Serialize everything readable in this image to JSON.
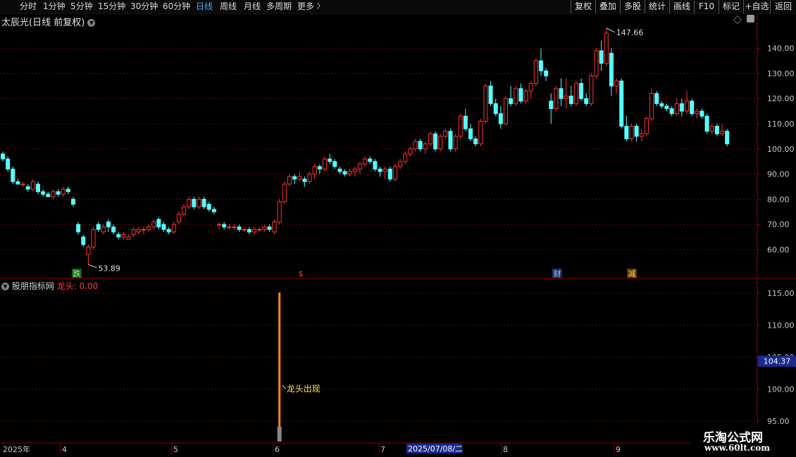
{
  "toolbar": {
    "periods": [
      {
        "label": "分时",
        "active": false
      },
      {
        "label": "1分钟",
        "active": false
      },
      {
        "label": "5分钟",
        "active": false
      },
      {
        "label": "15分钟",
        "active": false
      },
      {
        "label": "30分钟",
        "active": false
      },
      {
        "label": "60分钟",
        "active": false
      },
      {
        "label": "日线",
        "active": true
      },
      {
        "label": "周线",
        "active": false
      },
      {
        "label": "月线",
        "active": false
      },
      {
        "label": "多周期",
        "active": false
      },
      {
        "label": "更多",
        "active": false
      }
    ],
    "more_arrow": "〉",
    "right_buttons": [
      "复权",
      "叠加",
      "多股",
      "统计",
      "画线",
      "F10",
      "标记",
      "+自选",
      "返回"
    ]
  },
  "stock": {
    "title": "太辰光(日线 前复权)",
    "chevron": "chevron-down-icon"
  },
  "main_chart": {
    "price_ticks": [
      "140.00",
      "130.00",
      "120.00",
      "110.00",
      "100.00",
      "90.00",
      "80.00",
      "70.00",
      "60.00"
    ],
    "high_label": "147.66",
    "low_label": "53.89",
    "markers": [
      {
        "text": "跌",
        "type": "green-box"
      },
      {
        "text": "$",
        "type": "red-text"
      },
      {
        "text": "财",
        "type": "blue-box"
      },
      {
        "text": "减",
        "type": "amber-box"
      }
    ]
  },
  "sub_chart": {
    "title": "股朋指标网",
    "indicator_label": "龙头: 0.00",
    "ticks": [
      "115.00",
      "110.00",
      "105.00",
      "100.00",
      "95.00"
    ],
    "current_value": "104.37",
    "signal_text": "龙头出现"
  },
  "time_axis": {
    "labels": [
      "2025年",
      "4",
      "5",
      "6",
      "7",
      "8",
      "9"
    ],
    "cursor_date": "2025/07/08/二"
  },
  "watermark": {
    "line1": "乐淘公式网",
    "line2": "www.60lt.com"
  },
  "colors": {
    "up": "#ff3232",
    "down": "#54ffff",
    "grid": "#6e0000",
    "axis": "#8a0000",
    "accent": "#4aa8ff",
    "signal": "#ff8c00"
  },
  "chart_data": {
    "type": "candlestick",
    "ylim": [
      50,
      150
    ],
    "y_ticks": [
      60,
      70,
      80,
      90,
      100,
      110,
      120,
      130,
      140
    ],
    "high": 147.66,
    "low": 53.89,
    "candles": [
      [
        98,
        99,
        95,
        96
      ],
      [
        96,
        97,
        91,
        92
      ],
      [
        92,
        93,
        86,
        87
      ],
      [
        87,
        88,
        86,
        86
      ],
      [
        86,
        87,
        85,
        86
      ],
      [
        85,
        86,
        83,
        84
      ],
      [
        84,
        88,
        83,
        87
      ],
      [
        86,
        87,
        82,
        83
      ],
      [
        83,
        84,
        81,
        82
      ],
      [
        82,
        83,
        81,
        81
      ],
      [
        81,
        84,
        80,
        83
      ],
      [
        83,
        84,
        81,
        82
      ],
      [
        82,
        85,
        81,
        84
      ],
      [
        84,
        85,
        82,
        83
      ],
      [
        80,
        81,
        77,
        78
      ],
      [
        70,
        71,
        66,
        67
      ],
      [
        65,
        66,
        61,
        62
      ],
      [
        58,
        62,
        54,
        61
      ],
      [
        61,
        69,
        60,
        68
      ],
      [
        70,
        71,
        67,
        68
      ],
      [
        67,
        70,
        66,
        69
      ],
      [
        71,
        72,
        67,
        69
      ],
      [
        69,
        70,
        66,
        67
      ],
      [
        66,
        67,
        64,
        65
      ],
      [
        65,
        67,
        64,
        66
      ],
      [
        64,
        66,
        64,
        65
      ],
      [
        66,
        69,
        65,
        68
      ],
      [
        67,
        69,
        66,
        68
      ],
      [
        68,
        69,
        66,
        68
      ],
      [
        68,
        70,
        67,
        69
      ],
      [
        69,
        72,
        68,
        71
      ],
      [
        72,
        73,
        68,
        69
      ],
      [
        70,
        71,
        67,
        68
      ],
      [
        68,
        69,
        66,
        67
      ],
      [
        67,
        71,
        66,
        70
      ],
      [
        71,
        75,
        70,
        74
      ],
      [
        74,
        78,
        73,
        77
      ],
      [
        77,
        81,
        76,
        80
      ],
      [
        80,
        81,
        76,
        77
      ],
      [
        77,
        81,
        76,
        80
      ],
      [
        80,
        81,
        76,
        77
      ],
      [
        78,
        79,
        75,
        76
      ],
      [
        76,
        77,
        74,
        75
      ],
      [
        70,
        71,
        68,
        70
      ],
      [
        70,
        71,
        68,
        69
      ],
      [
        69,
        70,
        68,
        69
      ],
      [
        69,
        70,
        68,
        69
      ],
      [
        69,
        70,
        67,
        68
      ],
      [
        68,
        69,
        67,
        68
      ],
      [
        68,
        69,
        66,
        67
      ],
      [
        67,
        69,
        66,
        68
      ],
      [
        68,
        69,
        67,
        68
      ],
      [
        68,
        70,
        67,
        69
      ],
      [
        69,
        70,
        67,
        68
      ],
      [
        67,
        72,
        66,
        71
      ],
      [
        71,
        80,
        70,
        79
      ],
      [
        79,
        87,
        78,
        86
      ],
      [
        86,
        90,
        85,
        89
      ],
      [
        89,
        90,
        86,
        88
      ],
      [
        88,
        91,
        87,
        89
      ],
      [
        88,
        89,
        85,
        87
      ],
      [
        87,
        91,
        86,
        90
      ],
      [
        90,
        94,
        88,
        93
      ],
      [
        93,
        94,
        90,
        92
      ],
      [
        92,
        97,
        91,
        96
      ],
      [
        96,
        98,
        94,
        95
      ],
      [
        95,
        96,
        92,
        93
      ],
      [
        92,
        93,
        90,
        91
      ],
      [
        91,
        92,
        89,
        90
      ],
      [
        90,
        92,
        89,
        91
      ],
      [
        91,
        93,
        89,
        92
      ],
      [
        92,
        95,
        90,
        94
      ],
      [
        94,
        97,
        93,
        96
      ],
      [
        96,
        97,
        94,
        95
      ],
      [
        95,
        96,
        91,
        92
      ],
      [
        92,
        93,
        89,
        91
      ],
      [
        91,
        93,
        88,
        92
      ],
      [
        92,
        93,
        87,
        88
      ],
      [
        88,
        94,
        87,
        93
      ],
      [
        93,
        96,
        92,
        95
      ],
      [
        95,
        99,
        94,
        98
      ],
      [
        98,
        101,
        97,
        100
      ],
      [
        100,
        104,
        99,
        103
      ],
      [
        103,
        104,
        99,
        100
      ],
      [
        100,
        103,
        98,
        102
      ],
      [
        102,
        107,
        101,
        106
      ],
      [
        106,
        107,
        99,
        100
      ],
      [
        100,
        106,
        99,
        105
      ],
      [
        105,
        108,
        104,
        107
      ],
      [
        107,
        108,
        99,
        100
      ],
      [
        100,
        106,
        99,
        105
      ],
      [
        105,
        114,
        104,
        113
      ],
      [
        113,
        116,
        107,
        108
      ],
      [
        108,
        110,
        103,
        104
      ],
      [
        104,
        105,
        101,
        102
      ],
      [
        102,
        112,
        101,
        111
      ],
      [
        111,
        126,
        110,
        125
      ],
      [
        125,
        127,
        117,
        118
      ],
      [
        118,
        120,
        113,
        114
      ],
      [
        114,
        117,
        108,
        110
      ],
      [
        110,
        121,
        109,
        120
      ],
      [
        120,
        125,
        117,
        118
      ],
      [
        118,
        125,
        117,
        124
      ],
      [
        124,
        126,
        118,
        119
      ],
      [
        119,
        124,
        118,
        123
      ],
      [
        123,
        127,
        120,
        126
      ],
      [
        126,
        136,
        125,
        135
      ],
      [
        135,
        140,
        129,
        131
      ],
      [
        131,
        132,
        127,
        129
      ],
      [
        119,
        122,
        110,
        116
      ],
      [
        116,
        125,
        115,
        124
      ],
      [
        124,
        128,
        117,
        120
      ],
      [
        120,
        128,
        116,
        121
      ],
      [
        121,
        125,
        117,
        118
      ],
      [
        118,
        127,
        117,
        126
      ],
      [
        126,
        128,
        119,
        120
      ],
      [
        120,
        122,
        117,
        118
      ],
      [
        118,
        130,
        117,
        129
      ],
      [
        129,
        140,
        128,
        139
      ],
      [
        139,
        143,
        131,
        134
      ],
      [
        134,
        148,
        133,
        146
      ],
      [
        138,
        140,
        121,
        125
      ],
      [
        125,
        128,
        122,
        127
      ],
      [
        127,
        128,
        108,
        109
      ],
      [
        109,
        113,
        103,
        104
      ],
      [
        104,
        110,
        103,
        109
      ],
      [
        109,
        110,
        103,
        105
      ],
      [
        105,
        108,
        103,
        106
      ],
      [
        106,
        113,
        105,
        112
      ],
      [
        112,
        124,
        111,
        122
      ],
      [
        122,
        123,
        117,
        118
      ],
      [
        118,
        119,
        116,
        117
      ],
      [
        117,
        118,
        115,
        116
      ],
      [
        116,
        117,
        113,
        114
      ],
      [
        114,
        120,
        113,
        118
      ],
      [
        118,
        120,
        113,
        115
      ],
      [
        115,
        123,
        114,
        119
      ],
      [
        119,
        120,
        113,
        114
      ],
      [
        114,
        116,
        112,
        115
      ],
      [
        115,
        116,
        112,
        113
      ],
      [
        113,
        114,
        106,
        107
      ],
      [
        107,
        110,
        106,
        109
      ],
      [
        109,
        110,
        105,
        106
      ],
      [
        106,
        110,
        105,
        107
      ],
      [
        107,
        108,
        101,
        102
      ]
    ],
    "sub_ylim": [
      95,
      117
    ],
    "sub_ticks": [
      115,
      110,
      105,
      100,
      95
    ],
    "sub_value": 104.37,
    "signal_candle_index": 55
  }
}
